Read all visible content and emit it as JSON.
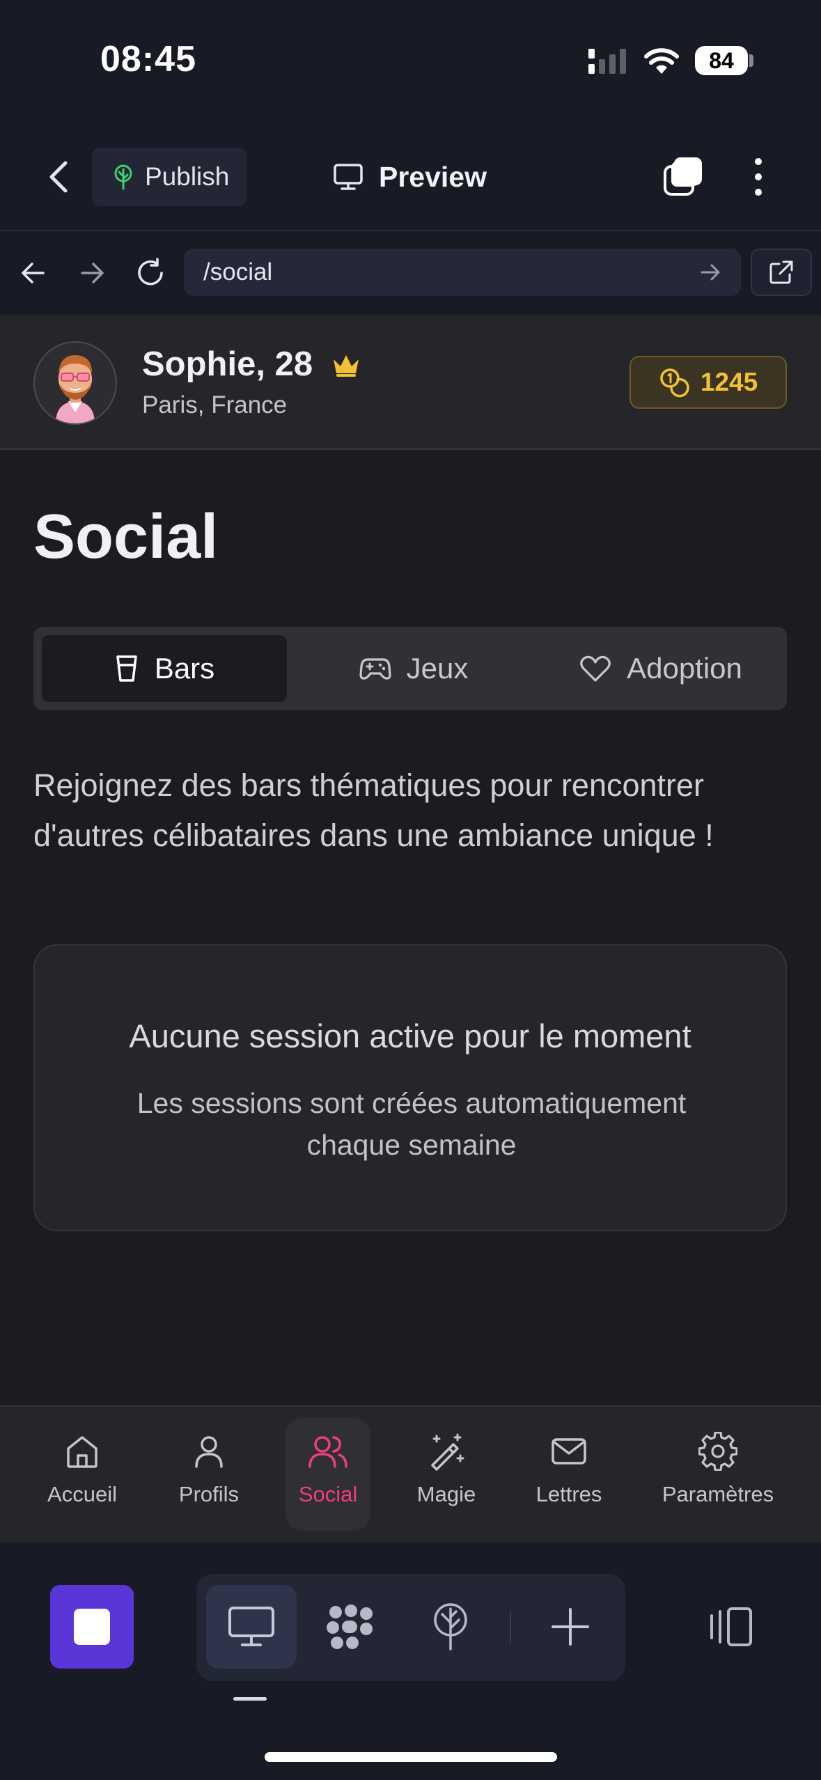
{
  "status_bar": {
    "time": "08:45",
    "battery": "84"
  },
  "builder": {
    "publish_label": "Publish",
    "preview_label": "Preview",
    "url_path": "/social"
  },
  "user": {
    "name_age": "Sophie, 28",
    "location": "Paris, France",
    "coins": "1245"
  },
  "page": {
    "title": "Social",
    "tabs": [
      {
        "label": "Bars",
        "icon": "glass-icon",
        "active": true
      },
      {
        "label": "Jeux",
        "icon": "gamepad-icon",
        "active": false
      },
      {
        "label": "Adoption",
        "icon": "heart-icon",
        "active": false
      }
    ],
    "intro": "Rejoignez des bars thématiques pour rencontrer d'autres célibataires dans une ambiance unique !",
    "empty_state": {
      "title": "Aucune session active pour le moment",
      "subtitle": "Les sessions sont créées automatiquement chaque semaine"
    }
  },
  "bottom_nav": [
    {
      "label": "Accueil",
      "icon": "home-icon",
      "active": false
    },
    {
      "label": "Profils",
      "icon": "user-icon",
      "active": false
    },
    {
      "label": "Social",
      "icon": "users-icon",
      "active": true
    },
    {
      "label": "Magie",
      "icon": "magic-wand-icon",
      "active": false
    },
    {
      "label": "Lettres",
      "icon": "mail-icon",
      "active": false
    },
    {
      "label": "Paramètres",
      "icon": "gear-icon",
      "active": false
    }
  ],
  "colors": {
    "accent_pink": "#ec3f7f",
    "coin_gold": "#f3c234",
    "stop_purple": "#5a35d8",
    "publish_green": "#3ecf6e"
  }
}
